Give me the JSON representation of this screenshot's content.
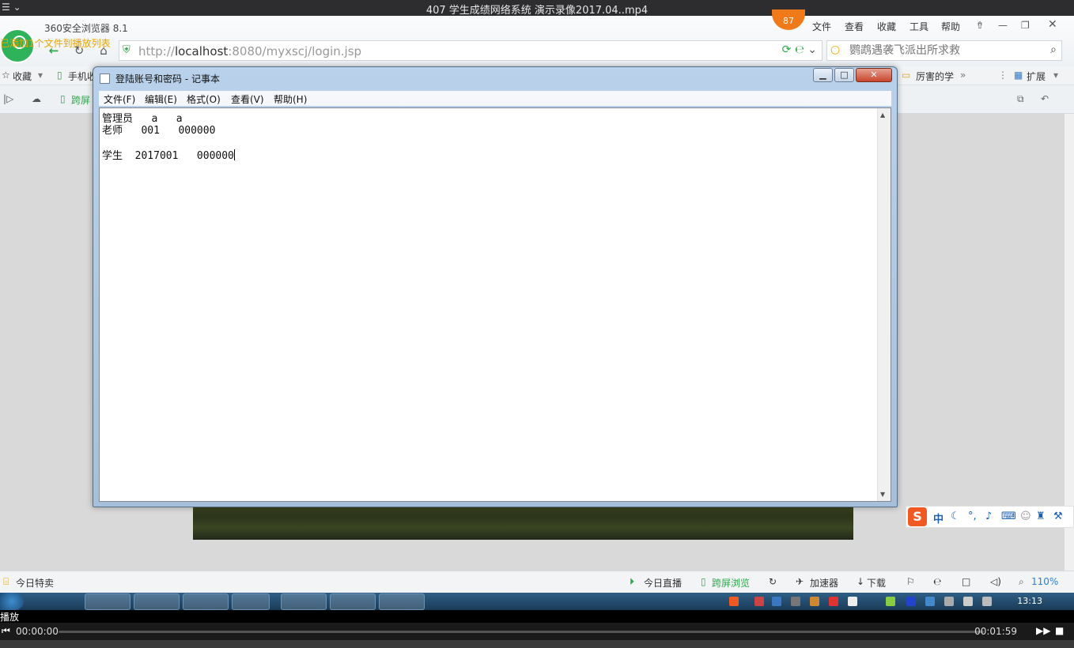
{
  "player": {
    "title": "407 学生成绩网络系统 演示录像2017.04..mp4",
    "status": "播放",
    "time_current": "00:00:00",
    "time_total": "00:01:59",
    "progress": 0
  },
  "browser": {
    "name": "360安全浏览器 8.1",
    "overlay_notice": "已添加1个文件到播放列表",
    "badge": "87",
    "menu": [
      "文件",
      "查看",
      "收藏",
      "工具",
      "帮助"
    ],
    "url_prefix": "http://",
    "url_host": "localhost",
    "url_rest": ":8080/myxscj/login.jsp",
    "search_placeholder": "鹦鹉遇袭飞派出所求救",
    "bookmarks": {
      "favorites": "收藏",
      "mobile": "手机收",
      "right_item": "厉害的学",
      "extensions": "扩展"
    },
    "tab_label": "跨屏",
    "status": {
      "deals": "今日特卖",
      "live": "今日直播",
      "cross_screen": "跨屏浏览",
      "accelerator": "加速器",
      "download": "下载",
      "zoom": "110%"
    }
  },
  "notepad": {
    "title": "登陆账号和密码 - 记事本",
    "menu": [
      "文件(F)",
      "编辑(E)",
      "格式(O)",
      "查看(V)",
      "帮助(H)"
    ],
    "lines": [
      "管理员   a   a",
      "老师   001   000000",
      "",
      "学生  2017001   000000"
    ]
  },
  "ime": {
    "mode": "中"
  },
  "taskbar": {
    "clock": "13:13"
  },
  "colors": {
    "accent_green": "#2ba84a",
    "close_red": "#c8462c",
    "ime_orange": "#f05a22"
  }
}
